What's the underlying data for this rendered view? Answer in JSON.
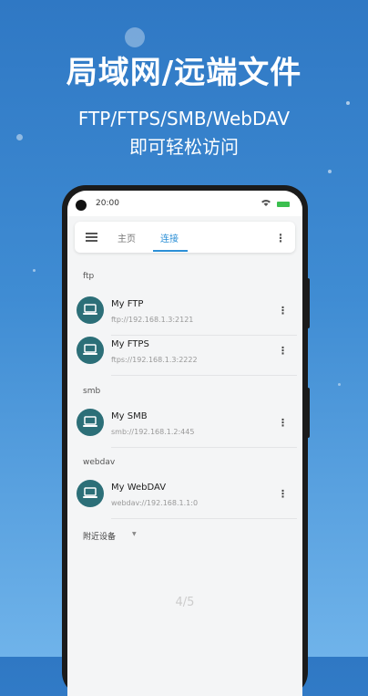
{
  "promo": {
    "headline": "局域网/远端文件",
    "protocols": "FTP/FTPS/SMB/WebDAV",
    "tagline": "即可轻松访问"
  },
  "status_bar": {
    "time": "20:00",
    "icons": [
      "wifi-icon",
      "battery-icon"
    ]
  },
  "app_bar": {
    "tabs": [
      {
        "label": "主页",
        "active": false
      },
      {
        "label": "连接",
        "active": true
      }
    ],
    "accent_color": "#2b8fd6"
  },
  "sections": [
    {
      "label": "ftp",
      "items": [
        {
          "name": "My FTP",
          "url": "ftp://192.168.1.3:2121"
        },
        {
          "name": "My FTPS",
          "url": "ftps://192.168.1.3:2222"
        }
      ]
    },
    {
      "label": "smb",
      "items": [
        {
          "name": "My SMB",
          "url": "smb://192.168.1.2:445"
        }
      ]
    },
    {
      "label": "webdav",
      "items": [
        {
          "name": "My WebDAV",
          "url": "webdav://192.168.1.1:0"
        }
      ]
    }
  ],
  "nearby": {
    "label": "附近设备"
  },
  "pager": "4/5",
  "colors": {
    "item_icon_bg": "#2c6f78"
  }
}
